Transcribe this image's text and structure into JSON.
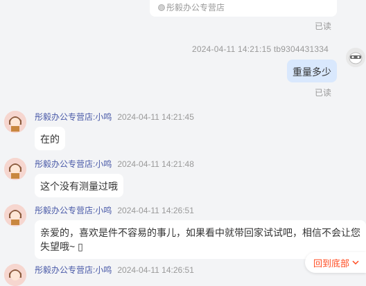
{
  "top_card": {
    "shop_label": "彤毅办公专营店"
  },
  "read_status": "已读",
  "my_message": {
    "meta": "2024-04-11 14:21:15  tb9304431334",
    "text": "重量多少"
  },
  "messages": [
    {
      "sender": "彤毅办公专营店:小鸣",
      "time": "2024-04-11 14:21:45",
      "text": "在的"
    },
    {
      "sender": "彤毅办公专营店:小鸣",
      "time": "2024-04-11 14:21:48",
      "text": "这个没有测量过哦"
    },
    {
      "sender": "彤毅办公专营店:小鸣",
      "time": "2024-04-11 14:26:51",
      "text_line1": "亲爱的，喜欢是件不容易的事儿，如果看中就带回家试试吧，相信不会让您",
      "text_line2": "失望哦~ ▯"
    },
    {
      "sender": "彤毅办公专营店:小鸣",
      "time": "2024-04-11 14:26:51"
    }
  ],
  "back_to_bottom": "回到底部",
  "colors": {
    "accent": "#ff4a1f",
    "my_bubble": "#d9e8fd",
    "sender": "#4a5aa8"
  }
}
